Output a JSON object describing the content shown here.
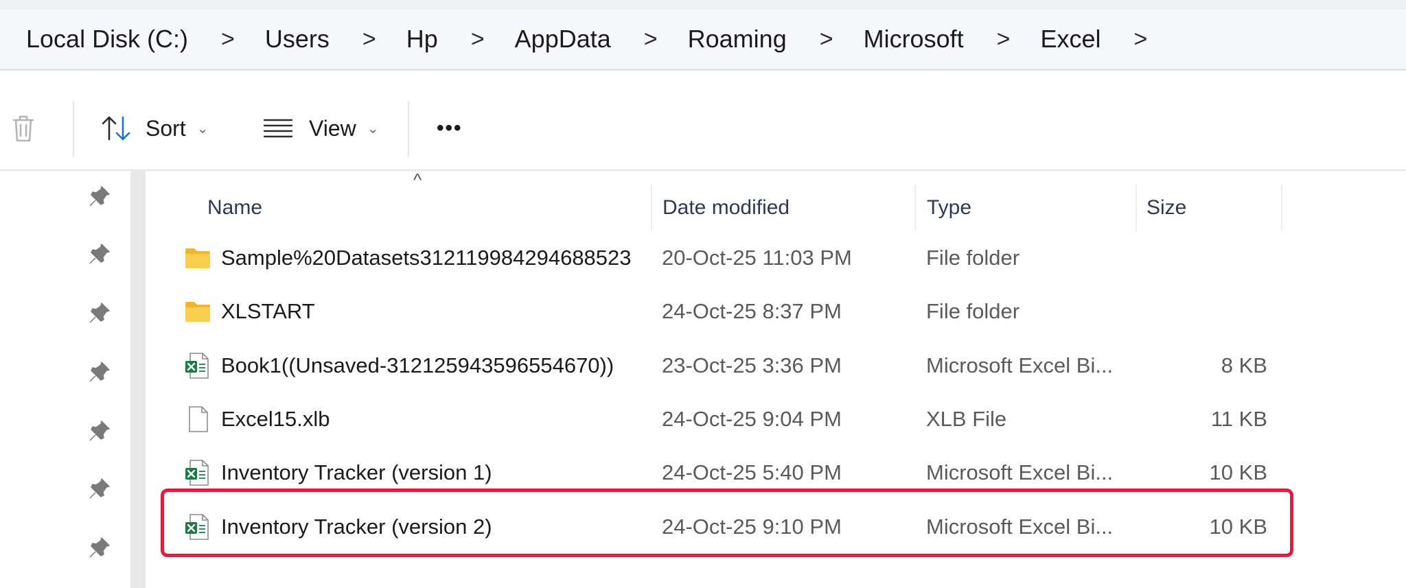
{
  "breadcrumb": [
    "Local Disk (C:)",
    "Users",
    "Hp",
    "AppData",
    "Roaming",
    "Microsoft",
    "Excel"
  ],
  "breadcrumb_separator": ">",
  "toolbar": {
    "sort_label": "Sort",
    "view_label": "View",
    "more_label": "•••",
    "caret": "⌄"
  },
  "columns": {
    "name": "Name",
    "date": "Date modified",
    "type": "Type",
    "size": "Size"
  },
  "sort_indicator": "^",
  "files": [
    {
      "name": "Sample%20Datasets312119984294688523",
      "date": "20-Oct-25 11:03 PM",
      "type": "File folder",
      "size": "",
      "icon": "folder-icon"
    },
    {
      "name": "XLSTART",
      "date": "24-Oct-25 8:37 PM",
      "type": "File folder",
      "size": "",
      "icon": "folder-icon"
    },
    {
      "name": "Book1((Unsaved-312125943596554670))",
      "date": "23-Oct-25 3:36 PM",
      "type": "Microsoft Excel Bi...",
      "size": "8 KB",
      "icon": "excel-file-icon"
    },
    {
      "name": "Excel15.xlb",
      "date": "24-Oct-25 9:04 PM",
      "type": "XLB File",
      "size": "11 KB",
      "icon": "blank-file-icon"
    },
    {
      "name": "Inventory Tracker (version 1)",
      "date": "24-Oct-25 5:40 PM",
      "type": "Microsoft Excel Bi...",
      "size": "10 KB",
      "icon": "excel-file-icon"
    },
    {
      "name": "Inventory Tracker (version 2)",
      "date": "24-Oct-25 9:10 PM",
      "type": "Microsoft Excel Bi...",
      "size": "10 KB",
      "icon": "excel-file-icon"
    }
  ],
  "highlighted_row": 5,
  "colors": {
    "highlight": "#e8193c",
    "folder": "#f7c542",
    "excel_green": "#1d7a45",
    "sort_accent": "#1a73c8"
  }
}
